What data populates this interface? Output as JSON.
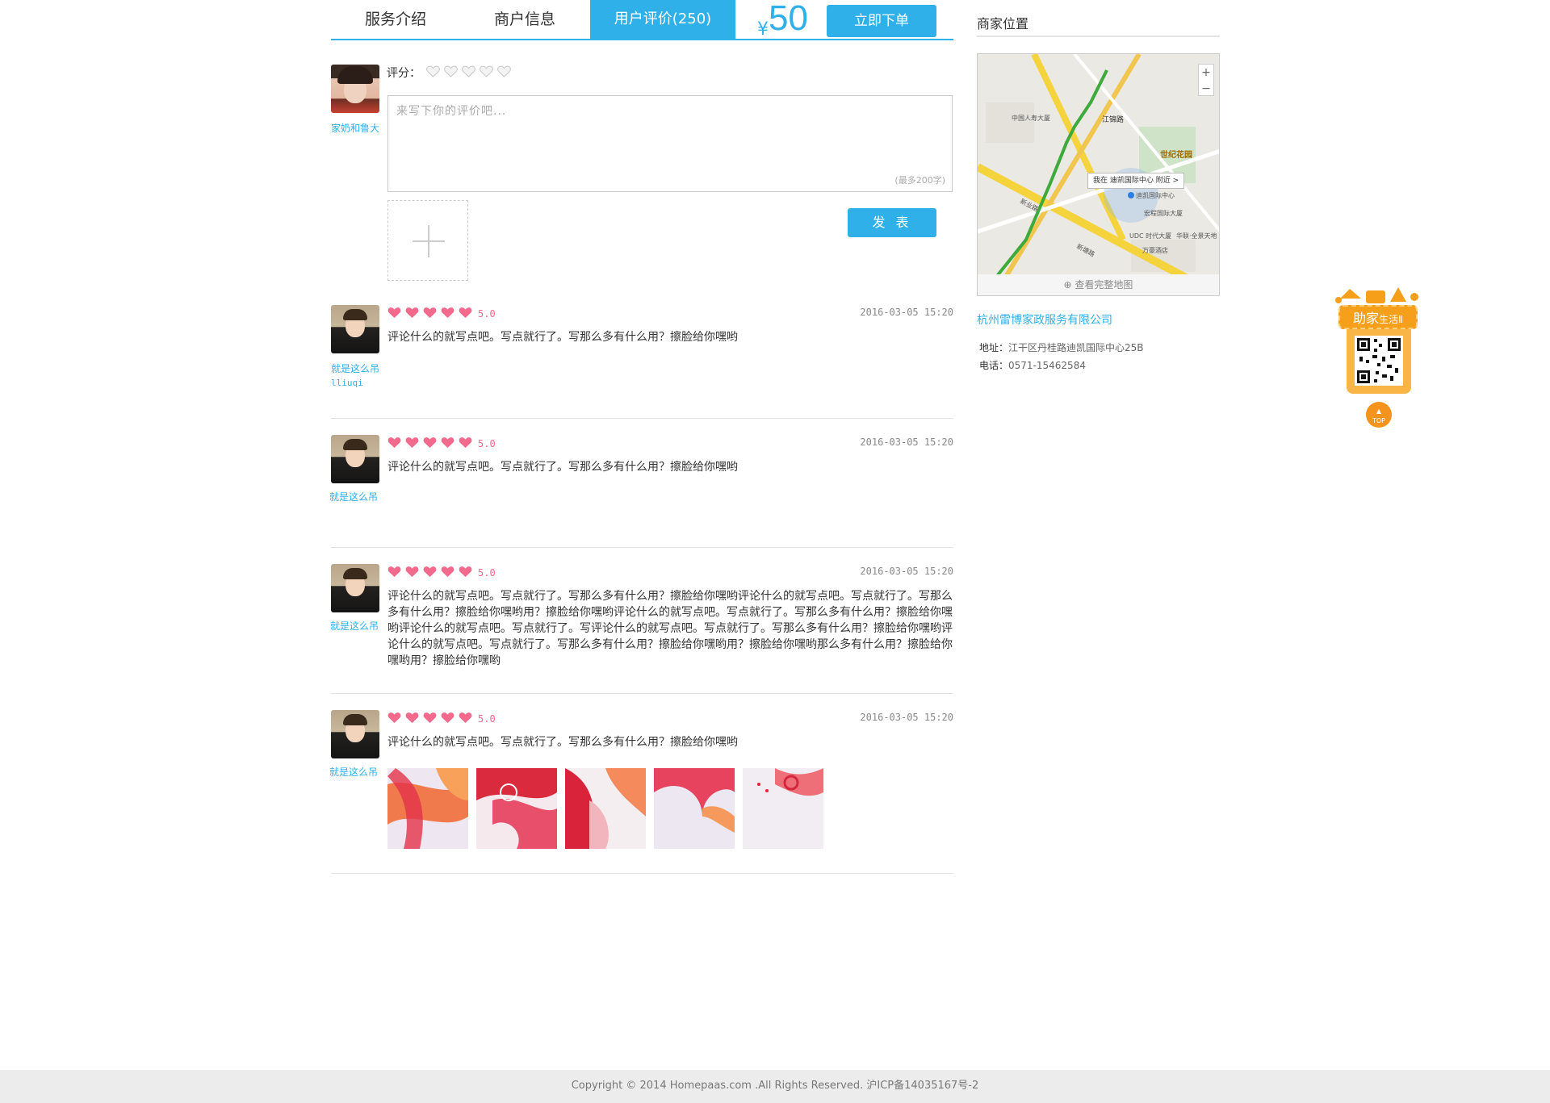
{
  "tabs": {
    "service": "服务介绍",
    "merchant": "商户信息",
    "reviews": "用户评价(250)"
  },
  "price": {
    "currency": "¥",
    "amount": "50"
  },
  "order_button": "立即下单",
  "composer": {
    "username": "家奶和鲁大",
    "rating_label": "评分：",
    "rating_value": 0,
    "placeholder": "来写下你的评价吧...",
    "max_hint": "(最多200字)",
    "publish_button": "发 表"
  },
  "reviews": [
    {
      "username": "就是这么吊",
      "user_id": "lliuqi",
      "score": "5.0",
      "rating": 5,
      "date": "2016-03-05 15:20",
      "content": "评论什么的就写点吧。写点就行了。写那么多有什么用？擦脸给你嘿哟"
    },
    {
      "username": "就是这么吊",
      "score": "5.0",
      "rating": 5,
      "date": "2016-03-05 15:20",
      "content": "评论什么的就写点吧。写点就行了。写那么多有什么用？擦脸给你嘿哟"
    },
    {
      "username": "就是这么吊",
      "score": "5.0",
      "rating": 5,
      "date": "2016-03-05 15:20",
      "content": "评论什么的就写点吧。写点就行了。写那么多有什么用？擦脸给你嘿哟评论什么的就写点吧。写点就行了。写那么多有什么用？擦脸给你嘿哟用？擦脸给你嘿哟评论什么的就写点吧。写点就行了。写那么多有什么用？擦脸给你嘿哟评论什么的就写点吧。写点就行了。写评论什么的就写点吧。写点就行了。写那么多有什么用？擦脸给你嘿哟评论什么的就写点吧。写点就行了。写那么多有什么用？擦脸给你嘿哟用？擦脸给你嘿哟那么多有什么用？擦脸给你嘿哟用？擦脸给你嘿哟"
    },
    {
      "username": "就是这么吊",
      "score": "5.0",
      "rating": 5,
      "date": "2016-03-05 15:20",
      "content": "评论什么的就写点吧。写点就行了。写那么多有什么用？擦脸给你嘿哟",
      "photo_count": 5
    }
  ],
  "sidebar": {
    "title": "商家位置",
    "map_callout": "我在 迪凯国际中心 附近 >",
    "map_footer": "查看完整地图",
    "map_labels": {
      "road_1": "江锦路",
      "park": "世纪花园",
      "bldg_1": "中国人寿大厦",
      "bldg_2": "迪凯国际中心",
      "bldg_3": "宏程国际大厦",
      "bldg_4": "UDC 时代大厦",
      "bldg_5": "万豪酒店",
      "bldg_6": "华联·全景天地",
      "road_2": "新业路",
      "road_3": "新塘路"
    },
    "company": "杭州雷博家政服务有限公司",
    "address_label": "地址：",
    "address": "江干区丹桂路迪凯国际中心25B",
    "phone_label": "电话：",
    "phone": "0571-15462584"
  },
  "float_widget": {
    "brand": "助家",
    "brand_suffix": "生活Ⅱ",
    "top_label": "TOP"
  },
  "footer": "Copyright © 2014 Homepaas.com .All Rights Reserved. 沪ICP备14035167号-2",
  "colors": {
    "accent": "#2fb0e8",
    "heart": "#f36a8d",
    "orange": "#f59f1a"
  }
}
